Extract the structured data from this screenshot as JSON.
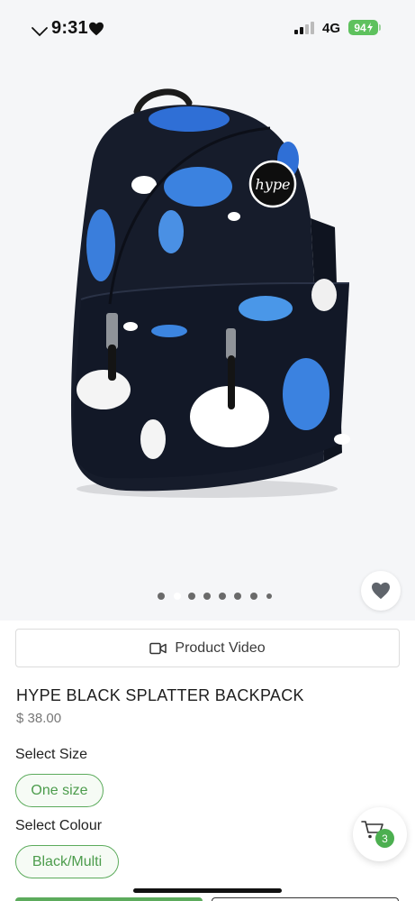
{
  "status_bar": {
    "time": "9:31",
    "network": "4G",
    "battery": "94"
  },
  "gallery": {
    "image_count": 8,
    "active_index": 1,
    "favorite_icon": "heart-icon"
  },
  "product_video": {
    "label": "Product Video",
    "icon": "video-camera-icon"
  },
  "product": {
    "name": "HYPE BLACK SPLATTER BACKPACK",
    "price": "$ 38.00"
  },
  "options": {
    "size_label": "Select Size",
    "size_value": "One size",
    "colour_label": "Select Colour",
    "colour_value": "Black/Multi"
  },
  "cart": {
    "icon": "cart-icon",
    "count": "3"
  },
  "colors": {
    "accent_green": "#5cab5c",
    "badge_green": "#4caf50",
    "battery_green": "#5ec15e"
  }
}
